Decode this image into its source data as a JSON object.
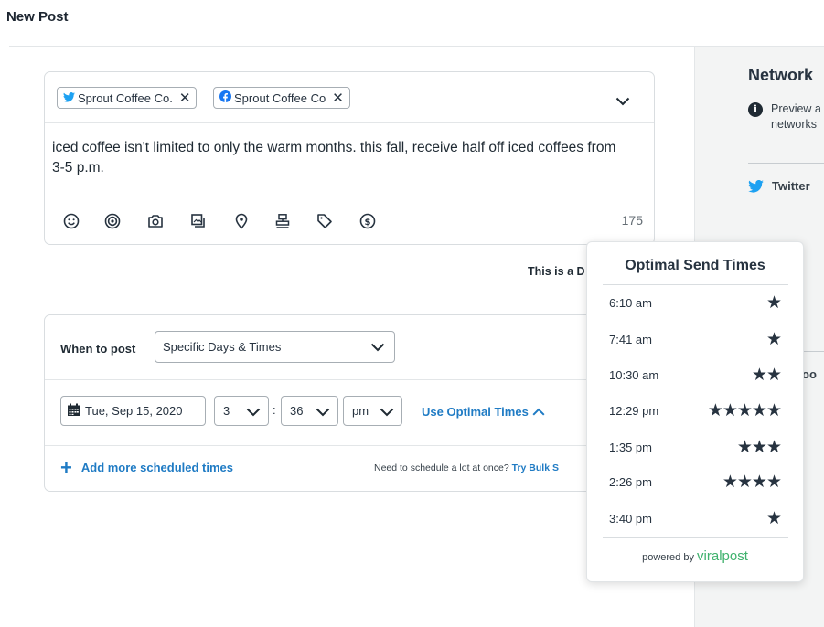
{
  "page": {
    "title": "New Post"
  },
  "compose": {
    "profiles": [
      {
        "network": "twitter",
        "name": "Sprout Coffee Co."
      },
      {
        "network": "facebook",
        "name": "Sprout Coffee Co"
      }
    ],
    "message": "iced coffee isn't limited to only the warm months. this fall, receive half off iced coffees from 3-5 p.m.",
    "char_count": "175",
    "toolbar_icons": [
      "emoji-icon",
      "target-icon",
      "camera-icon",
      "gallery-icon",
      "location-icon",
      "stamp-icon",
      "tag-icon",
      "dollar-icon"
    ]
  },
  "draft_note": "This is a D",
  "schedule": {
    "when_label": "When to post",
    "when_value": "Specific Days & Times",
    "date": "Tue, Sep 15, 2020",
    "hour": "3",
    "minute": "36",
    "ampm": "pm",
    "optimal_link": "Use Optimal Times",
    "add_more": "Add more scheduled times",
    "bulk_note": "Need to schedule a lot at once?",
    "bulk_link": "Try Bulk S"
  },
  "right_panel": {
    "title": "Network",
    "preview_line1": "Preview a",
    "preview_line2": "networks",
    "twitter_label": "Twitter",
    "faint_text": "oo"
  },
  "popover": {
    "title": "Optimal Send Times",
    "times": [
      {
        "time": "6:10 am",
        "stars": 1
      },
      {
        "time": "7:41 am",
        "stars": 1
      },
      {
        "time": "10:30 am",
        "stars": 2
      },
      {
        "time": "12:29 pm",
        "stars": 5
      },
      {
        "time": "1:35 pm",
        "stars": 3
      },
      {
        "time": "2:26 pm",
        "stars": 4
      },
      {
        "time": "3:40 pm",
        "stars": 1
      }
    ],
    "powered_by": "powered by",
    "brand": "viralpost"
  },
  "colors": {
    "link": "#1f7bc4",
    "twitter": "#1da1f2",
    "facebook": "#1877f2",
    "brand": "#3fb26d"
  }
}
